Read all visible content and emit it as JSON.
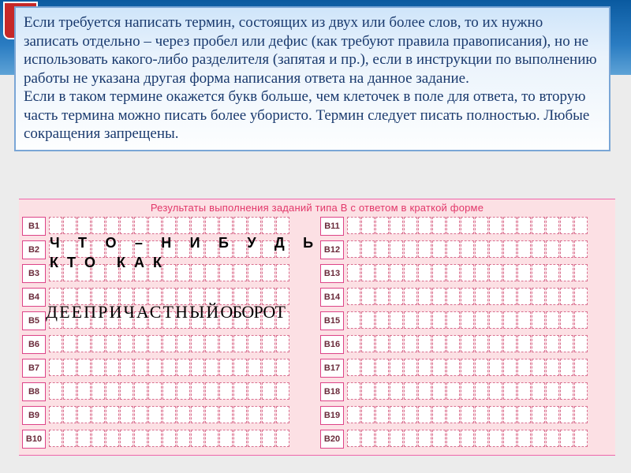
{
  "instruction": {
    "paragraph1": "Если требуется написать термин, состоящих из двух или более слов, то их нужно записать отдельно – через пробел или дефис (как требуют правила правописания), но не использовать какого-либо разделителя (запятая и пр.), если в инструкции по выполнению работы не указана другая форма написания ответа на данное задание.",
    "paragraph2": "Если в таком термине окажется букв больше, чем клеточек в поле для ответа, то вторую часть термина можно писать более убористо. Термин следует писать полностью. Любые сокращения запрещены."
  },
  "form": {
    "title": "Результаты выполнения заданий типа В с ответом в краткой форме",
    "left_labels": [
      "В1",
      "В2",
      "В3",
      "В4",
      "В5",
      "В6",
      "В7",
      "В8",
      "В9",
      "В10"
    ],
    "right_labels": [
      "В11",
      "В12",
      "В13",
      "В14",
      "В15",
      "В16",
      "В17",
      "В18",
      "В19",
      "В20"
    ]
  },
  "answers": {
    "line1": "Ч Т О – Н И Б У Д Ь",
    "line2_part1": "К Т О",
    "line2_part2": "К А К",
    "line3_part1": "ДЕЕПРИЧАСТНЫЙ",
    "line3_part2": "ОБОРОТ"
  },
  "chart_data": {
    "type": "table",
    "title": "Результаты выполнения заданий типа В с ответом в краткой форме",
    "rows": [
      {
        "id": "В1",
        "value": ""
      },
      {
        "id": "В2",
        "value": "ЧТО–НИБУДЬ"
      },
      {
        "id": "В3",
        "value": "КТО КАК"
      },
      {
        "id": "В4",
        "value": ""
      },
      {
        "id": "В5",
        "value": "ДЕЕПРИЧАСТНЫЙ ОБОРОТ"
      },
      {
        "id": "В6",
        "value": ""
      },
      {
        "id": "В7",
        "value": ""
      },
      {
        "id": "В8",
        "value": ""
      },
      {
        "id": "В9",
        "value": ""
      },
      {
        "id": "В10",
        "value": ""
      },
      {
        "id": "В11",
        "value": ""
      },
      {
        "id": "В12",
        "value": ""
      },
      {
        "id": "В13",
        "value": ""
      },
      {
        "id": "В14",
        "value": ""
      },
      {
        "id": "В15",
        "value": ""
      },
      {
        "id": "В16",
        "value": ""
      },
      {
        "id": "В17",
        "value": ""
      },
      {
        "id": "В18",
        "value": ""
      },
      {
        "id": "В19",
        "value": ""
      },
      {
        "id": "В20",
        "value": ""
      }
    ]
  }
}
